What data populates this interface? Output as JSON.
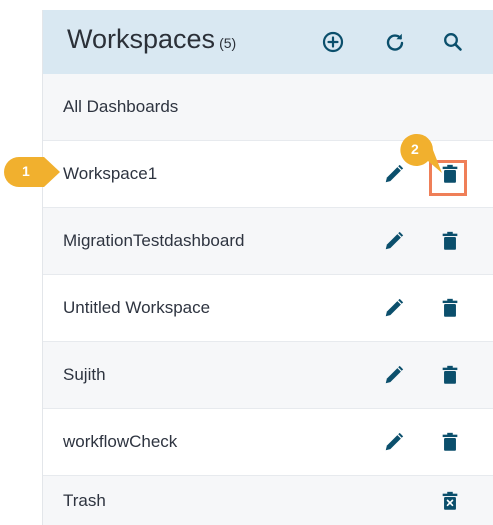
{
  "header": {
    "title": "Workspaces",
    "count": "(5)",
    "icons": {
      "add": "add-circle-icon",
      "refresh": "refresh-icon",
      "search": "search-icon"
    }
  },
  "list": {
    "all_dashboards": "All Dashboards",
    "workspaces": [
      {
        "label": "Workspace1"
      },
      {
        "label": "MigrationTestdashboard"
      },
      {
        "label": "Untitled Workspace"
      },
      {
        "label": "Sujith"
      },
      {
        "label": "workflowCheck"
      }
    ],
    "trash": "Trash"
  },
  "annotations": {
    "step1": "1",
    "step2": "2"
  },
  "colors": {
    "header_bg": "#d9e8f2",
    "icon": "#0b4f6c",
    "step_marker": "#f1b02e",
    "highlight": "#ef7f58"
  }
}
